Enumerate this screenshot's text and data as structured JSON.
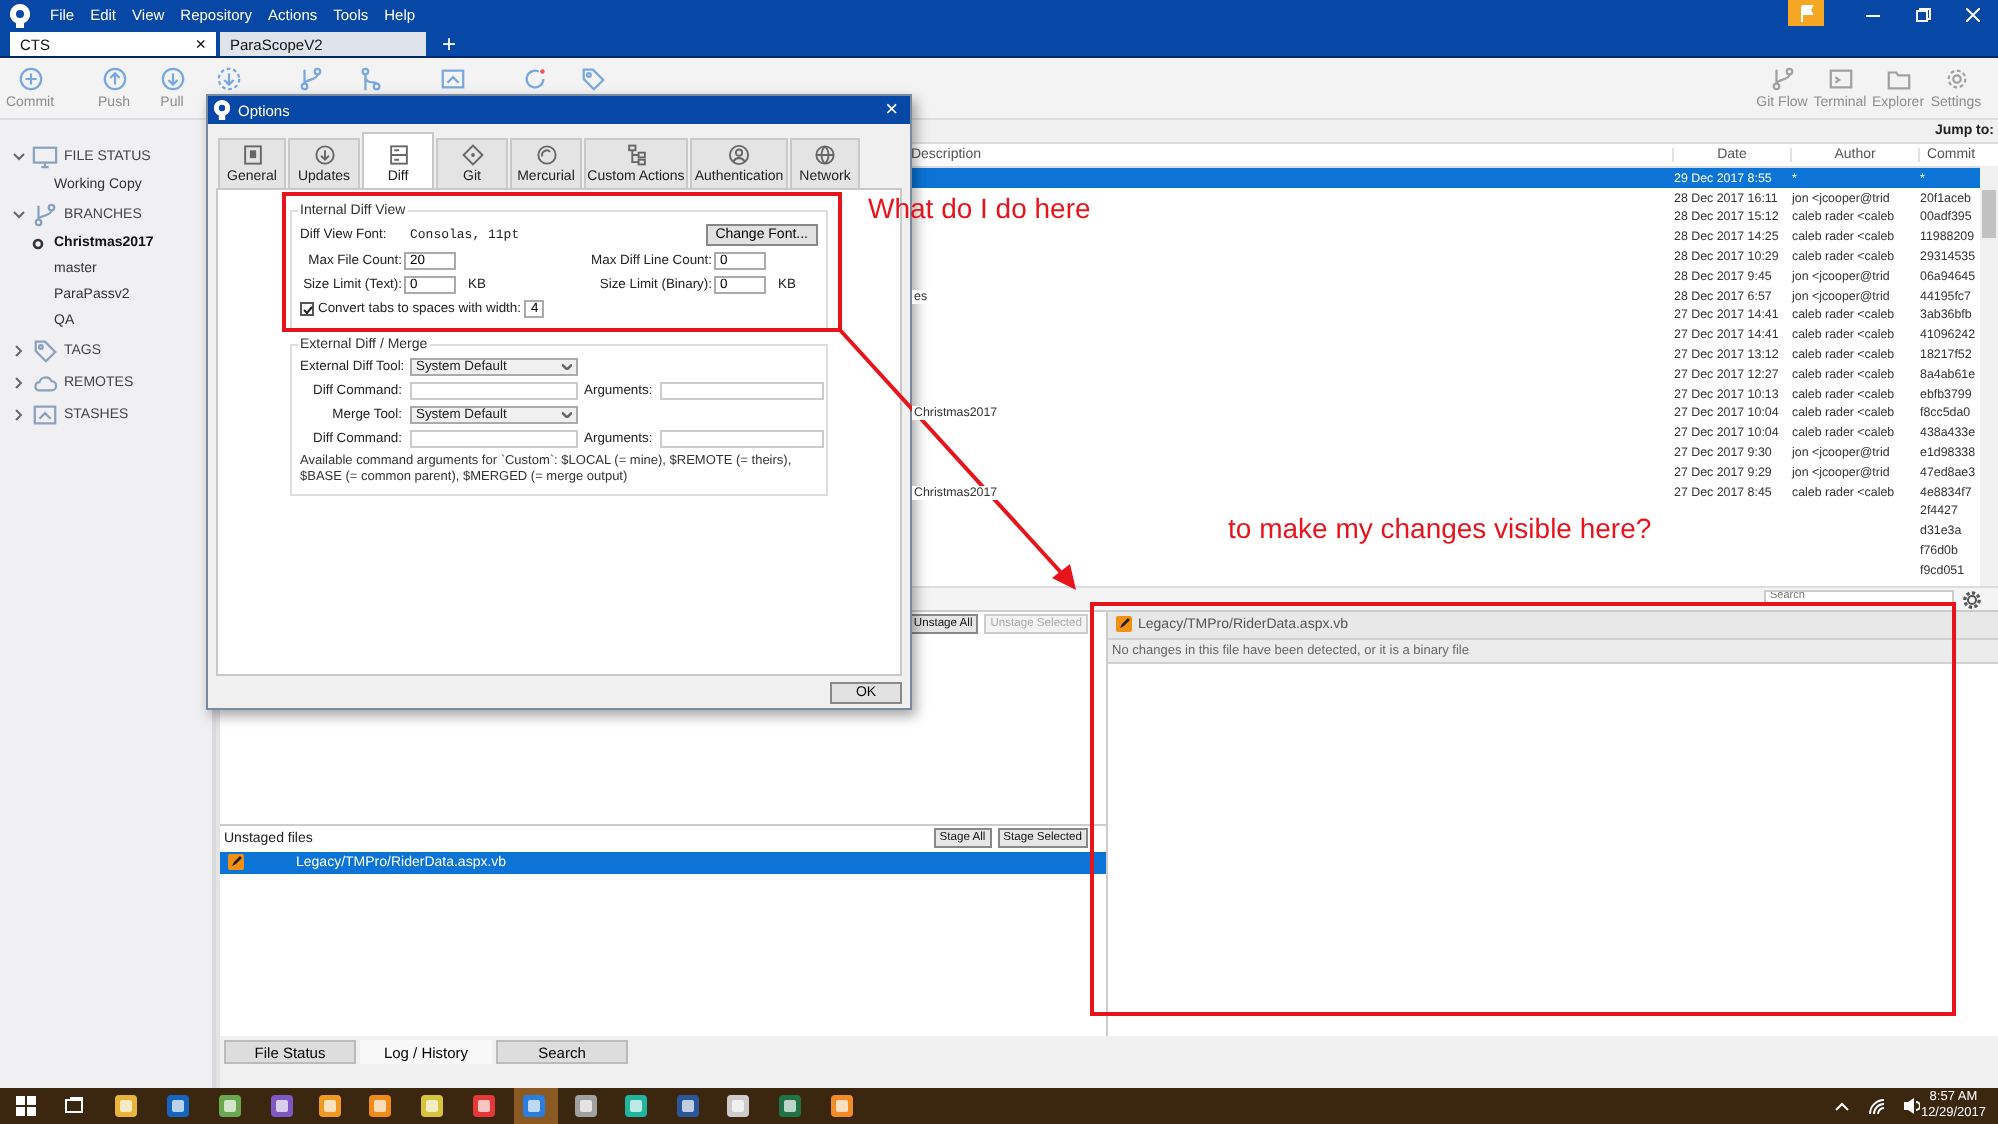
{
  "menu": [
    "File",
    "Edit",
    "View",
    "Repository",
    "Actions",
    "Tools",
    "Help"
  ],
  "repo_tabs": [
    {
      "label": "CTS",
      "selected": true,
      "close": "×"
    },
    {
      "label": "ParaScopeV2",
      "selected": false
    }
  ],
  "new_tab": "+",
  "toolbar_left": [
    {
      "label": "Commit",
      "kind": "plus"
    },
    {
      "label": "Push",
      "kind": "up"
    },
    {
      "label": "Pull",
      "kind": "down"
    },
    {
      "kind": "fetch"
    },
    {
      "kind": "branch"
    },
    {
      "kind": "merge"
    },
    {
      "kind": "stash"
    },
    {
      "kind": "discard"
    },
    {
      "kind": "tag"
    }
  ],
  "toolbar_right": [
    {
      "label": "Git Flow",
      "kind": "branch"
    },
    {
      "label": "Terminal",
      "kind": "terminal"
    },
    {
      "label": "Explorer",
      "kind": "folder"
    },
    {
      "label": "Settings",
      "kind": "gear"
    }
  ],
  "sidebar": [
    {
      "title": "FILE STATUS",
      "kind": "monitor",
      "expanded": true,
      "children": [
        {
          "label": "Working Copy",
          "current": false
        }
      ]
    },
    {
      "title": "BRANCHES",
      "kind": "branch",
      "expanded": true,
      "children": [
        {
          "label": "Christmas2017",
          "current": true
        },
        {
          "label": "master",
          "current": false
        },
        {
          "label": "ParaPassv2",
          "current": false
        },
        {
          "label": "QA",
          "current": false
        }
      ]
    },
    {
      "title": "TAGS",
      "kind": "tag",
      "expanded": false
    },
    {
      "title": "REMOTES",
      "kind": "cloud",
      "expanded": false
    },
    {
      "title": "STASHES",
      "kind": "stash",
      "expanded": false
    }
  ],
  "jump_label": "Jump to:",
  "commits": {
    "columns": [
      "Description",
      "Date",
      "Author",
      "Commit"
    ],
    "rows": [
      {
        "date": "29 Dec 2017 8:55",
        "author": "*",
        "commit": "*",
        "selected": true
      },
      {
        "date": "28 Dec 2017 16:11",
        "author": "jon <jcooper@trid",
        "commit": "20f1aceb",
        "selected": false
      },
      {
        "date": "28 Dec 2017 15:12",
        "author": "caleb rader <caleb",
        "commit": "00adf395",
        "selected": false
      },
      {
        "date": "28 Dec 2017 14:25",
        "author": "caleb rader <caleb",
        "commit": "11988209",
        "selected": false
      },
      {
        "date": "28 Dec 2017 10:29",
        "author": "caleb rader <caleb",
        "commit": "29314535",
        "selected": false
      },
      {
        "date": "28 Dec 2017 9:45",
        "author": "jon <jcooper@trid",
        "commit": "06a94645",
        "selected": false
      },
      {
        "description": "es",
        "date": "28 Dec 2017 6:57",
        "author": "jon <jcooper@trid",
        "commit": "44195fc7",
        "selected": false
      },
      {
        "date": "27 Dec 2017 14:41",
        "author": "caleb rader <caleb",
        "commit": "3ab36bfb",
        "selected": false
      },
      {
        "date": "27 Dec 2017 14:41",
        "author": "caleb rader <caleb",
        "commit": "41096242",
        "selected": false
      },
      {
        "date": "27 Dec 2017 13:12",
        "author": "caleb rader <caleb",
        "commit": "18217f52",
        "selected": false
      },
      {
        "date": "27 Dec 2017 12:27",
        "author": "caleb rader <caleb",
        "commit": "8a4ab61e",
        "selected": false
      },
      {
        "date": "27 Dec 2017 10:13",
        "author": "caleb rader <caleb",
        "commit": "ebfb3799",
        "selected": false
      },
      {
        "description": "Christmas2017",
        "date": "27 Dec 2017 10:04",
        "author": "caleb rader <caleb",
        "commit": "f8cc5da0",
        "selected": false
      },
      {
        "date": "27 Dec 2017 10:04",
        "author": "caleb rader <caleb",
        "commit": "438a433e",
        "selected": false
      },
      {
        "date": "27 Dec 2017 9:30",
        "author": "jon <jcooper@trid",
        "commit": "e1d98338",
        "selected": false
      },
      {
        "date": "27 Dec 2017 9:29",
        "author": "jon <jcooper@trid",
        "commit": "47ed8ae3",
        "selected": false
      },
      {
        "description": "Christmas2017",
        "date": "27 Dec 2017 8:45",
        "author": "caleb rader <caleb",
        "commit": "4e8834f7",
        "selected": false
      },
      {
        "commit": "2f4427",
        "selected": false
      },
      {
        "commit": "d31e3a",
        "selected": false
      },
      {
        "commit": "f76d0b",
        "selected": false
      },
      {
        "commit": "f9cd051",
        "selected": false
      }
    ]
  },
  "search": {
    "placeholder": "Search"
  },
  "staged": {
    "buttons": [
      {
        "label": "Unstage All",
        "disabled": false
      },
      {
        "label": "Unstage Selected",
        "disabled": true
      }
    ]
  },
  "unstaged": {
    "title": "Unstaged files",
    "buttons": [
      {
        "label": "Stage All",
        "disabled": false
      },
      {
        "label": "Stage Selected",
        "disabled": false
      }
    ],
    "files": [
      {
        "path": "Legacy/TMPro/RiderData.aspx.vb",
        "selected": true
      }
    ]
  },
  "diff": {
    "file": "Legacy/TMPro/RiderData.aspx.vb",
    "message": "No changes in this file have been detected, or it is a binary file"
  },
  "view_tabs": [
    {
      "label": "File Status",
      "selected": false
    },
    {
      "label": "Log / History",
      "selected": true
    },
    {
      "label": "Search",
      "selected": false
    }
  ],
  "dialog": {
    "title": "Options",
    "close": "×",
    "tabs": [
      {
        "label": "General",
        "kind": "general",
        "selected": false
      },
      {
        "label": "Updates",
        "kind": "updates",
        "selected": false
      },
      {
        "label": "Diff",
        "kind": "diff",
        "selected": true
      },
      {
        "label": "Git",
        "kind": "git",
        "selected": false
      },
      {
        "label": "Mercurial",
        "kind": "mercurial",
        "selected": false
      },
      {
        "label": "Custom Actions",
        "kind": "custom",
        "selected": false
      },
      {
        "label": "Authentication",
        "kind": "auth",
        "selected": false
      },
      {
        "label": "Network",
        "kind": "network",
        "selected": false
      }
    ],
    "internal": {
      "title": "Internal Diff View",
      "font_label": "Diff View Font:",
      "font_value": "Consolas, 11pt",
      "font_button": "Change Font...",
      "fields": [
        {
          "label": "Max File Count:",
          "value": "20"
        },
        {
          "label": "Max Diff Line Count:",
          "value": "0"
        },
        {
          "label": "Size Limit (Text):",
          "value": "0",
          "unit": "KB"
        },
        {
          "label": "Size Limit (Binary):",
          "value": "0",
          "unit": "KB"
        }
      ],
      "tabs_checkbox": {
        "label": "Convert tabs to spaces with width:",
        "checked": true,
        "value": "4"
      }
    },
    "external": {
      "title": "External Diff / Merge",
      "rows": [
        {
          "kind": "select",
          "label": "External Diff Tool:",
          "value": "System Default"
        },
        {
          "kind": "command",
          "label": "Diff Command:",
          "args_label": "Arguments:"
        },
        {
          "kind": "select",
          "label": "Merge Tool:",
          "value": "System Default"
        },
        {
          "kind": "command",
          "label": "Diff Command:",
          "args_label": "Arguments:"
        }
      ],
      "note": "Available command arguments for `Custom`: $LOCAL (= mine), $REMOTE (= theirs), $BASE (= common parent), $MERGED (= merge output)"
    },
    "ok": "OK"
  },
  "annotations": [
    "What do I do here",
    "to make my changes visible here?"
  ],
  "taskbar": {
    "time": "8:57 AM",
    "date": "12/29/2017"
  }
}
